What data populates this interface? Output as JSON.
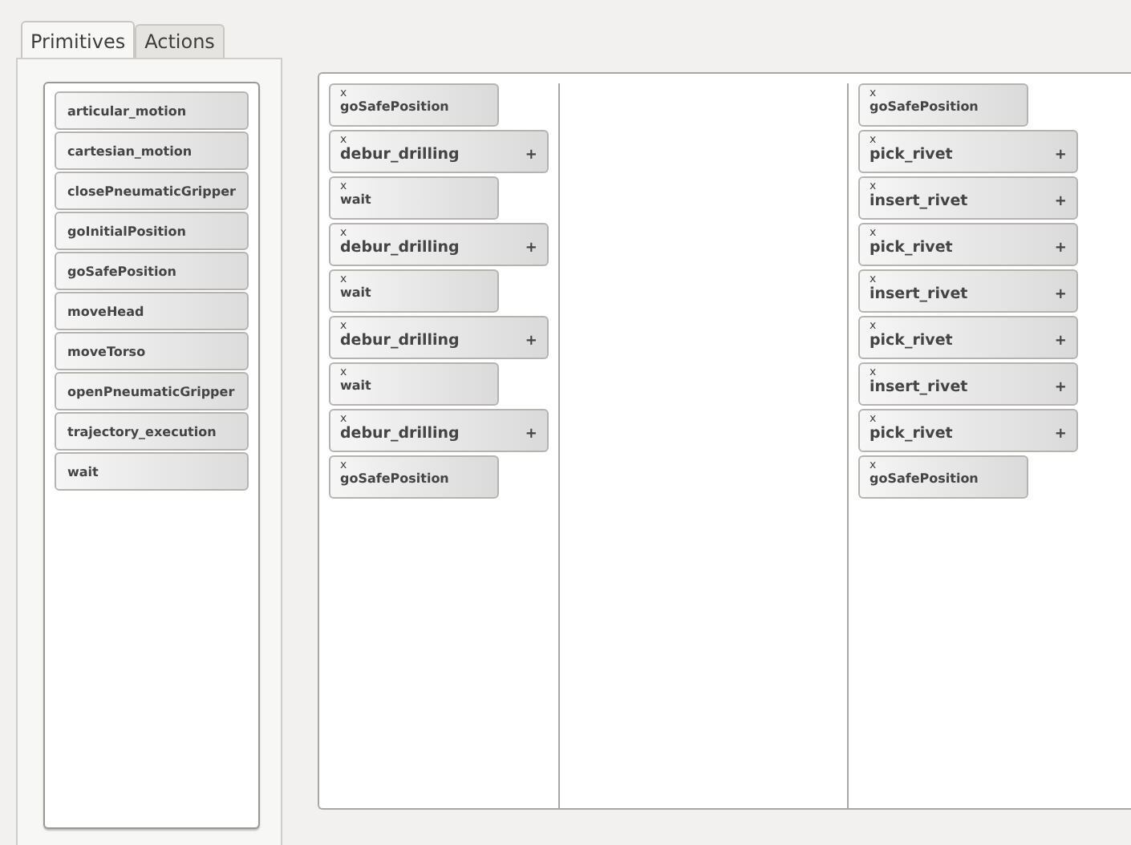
{
  "tabs": [
    {
      "label": "Primitives",
      "selected": true
    },
    {
      "label": "Actions",
      "selected": false
    }
  ],
  "primitives": [
    "articular_motion",
    "cartesian_motion",
    "closePneumaticGripper",
    "goInitialPosition",
    "goSafePosition",
    "moveHead",
    "moveTorso",
    "openPneumaticGripper",
    "trajectory_execution",
    "wait"
  ],
  "sequences": [
    {
      "kind": "filled",
      "blocks": [
        {
          "kind": "primitive",
          "remove": "x",
          "label": "goSafePosition"
        },
        {
          "kind": "action",
          "remove": "x",
          "label": "debur_drilling",
          "expand": "+"
        },
        {
          "kind": "primitive",
          "remove": "x",
          "label": "wait"
        },
        {
          "kind": "action",
          "remove": "x",
          "label": "debur_drilling",
          "expand": "+"
        },
        {
          "kind": "primitive",
          "remove": "x",
          "label": "wait"
        },
        {
          "kind": "action",
          "remove": "x",
          "label": "debur_drilling",
          "expand": "+"
        },
        {
          "kind": "primitive",
          "remove": "x",
          "label": "wait"
        },
        {
          "kind": "action",
          "remove": "x",
          "label": "debur_drilling",
          "expand": "+"
        },
        {
          "kind": "primitive",
          "remove": "x",
          "label": "goSafePosition"
        }
      ]
    },
    {
      "kind": "empty"
    },
    {
      "kind": "filled",
      "blocks": [
        {
          "kind": "primitive",
          "remove": "x",
          "label": "goSafePosition"
        },
        {
          "kind": "action",
          "remove": "x",
          "label": "pick_rivet",
          "expand": "+"
        },
        {
          "kind": "action",
          "remove": "x",
          "label": "insert_rivet",
          "expand": "+"
        },
        {
          "kind": "action",
          "remove": "x",
          "label": "pick_rivet",
          "expand": "+"
        },
        {
          "kind": "action",
          "remove": "x",
          "label": "insert_rivet",
          "expand": "+"
        },
        {
          "kind": "action",
          "remove": "x",
          "label": "pick_rivet",
          "expand": "+"
        },
        {
          "kind": "action",
          "remove": "x",
          "label": "insert_rivet",
          "expand": "+"
        },
        {
          "kind": "action",
          "remove": "x",
          "label": "pick_rivet",
          "expand": "+"
        },
        {
          "kind": "primitive",
          "remove": "x",
          "label": "goSafePosition"
        }
      ]
    }
  ]
}
